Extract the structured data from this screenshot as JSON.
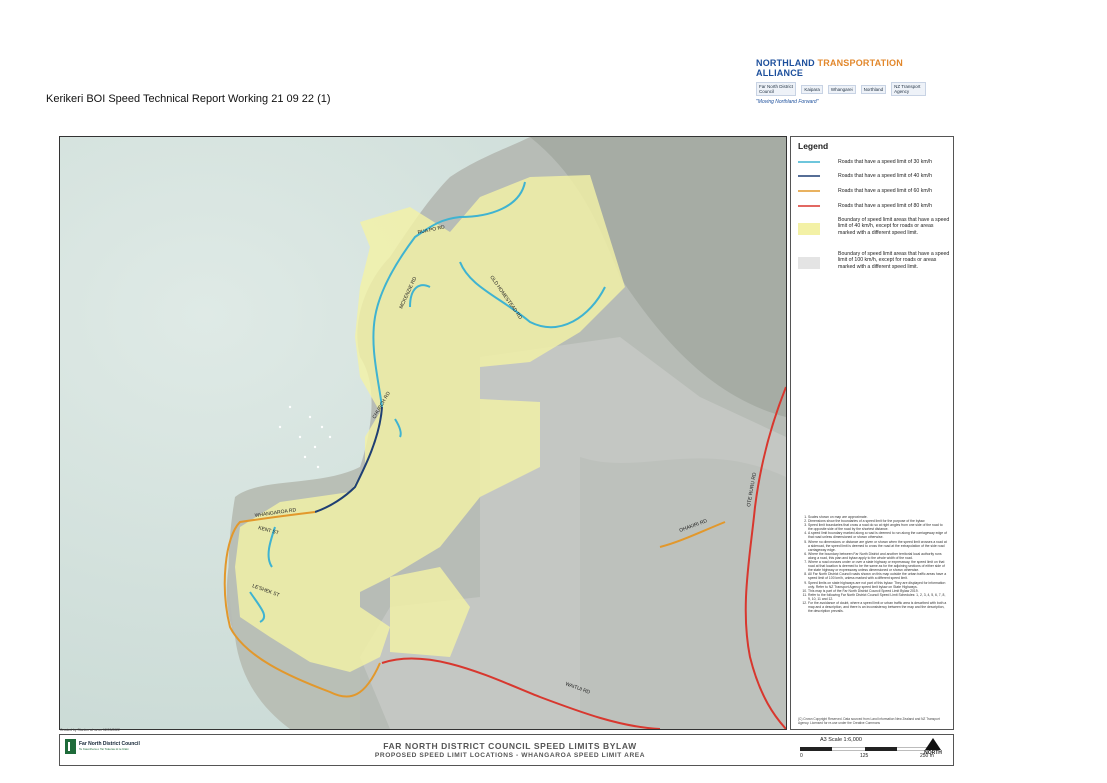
{
  "report_title": "Kerikeri BOI Speed Technical Report Working 21 09 22 (1)",
  "header_logo": {
    "name_part1": "NORTHLAND",
    "name_part2": "TRANSPORTATION",
    "name_part3": "ALLIANCE",
    "partners": [
      "Far North District Council",
      "Kaipara",
      "Whangarei",
      "Northland",
      "NZ Transport Agency"
    ],
    "tagline": "\"Moving Northland Forward\""
  },
  "legend": {
    "title": "Legend",
    "items": [
      {
        "label": "Roads that have a speed limit of 30 km/h",
        "color": "#3fb3d1",
        "kind": "line"
      },
      {
        "label": "Roads that have a speed limit of 40 km/h",
        "color": "#1f3f73",
        "kind": "line"
      },
      {
        "label": "Roads that have a speed limit of 60 km/h",
        "color": "#e2982c",
        "kind": "line"
      },
      {
        "label": "Roads that have a speed limit of 80 km/h",
        "color": "#d8372e",
        "kind": "line"
      },
      {
        "label": "Boundary of speed limit areas that have a speed limit of 40 km/h, except for roads or areas marked with a different speed limit.",
        "color": "#f3f1a6",
        "kind": "area"
      },
      {
        "label": "Boundary of speed limit areas that have a speed limit of 100 km/h, except for roads or areas marked with a different speed limit.",
        "color": "#e4e4e4",
        "kind": "area"
      }
    ],
    "notes": [
      "Scales shown on map are approximate.",
      "Dimensions show the boundaries of a speed limit for the purpose of the bylaw.",
      "Speed limit boundaries that cross a road do so at right angles from one side of the road to the opposite side of the road by the shortest distance.",
      "A speed limit boundary marked along a road is deemed to run along the carriageway edge of that road unless dimensioned or shown otherwise.",
      "Where no dimensions or distance are given or shown when the speed limit crosses a road at a sideroad, the speed limit is deemed to cross the road at the extrapolation of the side road carriageway edge.",
      "Where the boundary between Far North District and another territorial local authority runs along a road, this plan and bylaw apply to the whole width of the road.",
      "Where a road crosses under or over a state highway or expressway, the speed limit on that road at that location is deemed to be the same as for the adjoining sections of either side of the state highway or expressway unless dimensioned or shown otherwise.",
      "All Far North District Council roads shown on this map outside the urban traffic areas have a speed limit of 100 km/h, unless marked with a different speed limit.",
      "Speed limits on state highways are not part of this bylaw. They are displayed for information only. Refer to NZ Transport Agency speed limit bylaw on State Highways.",
      "This map is part of the Far North District Council Speed Limit Bylaw 2019.",
      "Refer to the following Far North District Council Speed Limit Schedules: 1, 2, 3, 4, 5, 6, 7, 8, 9, 10, 11 and 12.",
      "For the avoidance of doubt, where a speed limit or urban traffic area is described with both a map and a description, and there is an inconsistency between the map and the description, the description prevails."
    ],
    "copyright": "(C) Crown Copyright Reserved. Data sourced from Land Information New Zealand and NZ Transport Agency. Licensed for re-use under the Creative Commons"
  },
  "map": {
    "road_labels": [
      "RUA PO RD",
      "OLD HOMESTEAD RD",
      "MCKENZIE RD",
      "CHURCH RD",
      "WHANGAROA RD",
      "KENT ST",
      "LE'SHEK ST",
      "OHAKIRI RD",
      "OTE RURU RD",
      "WAITUI RD"
    ]
  },
  "credit": "Created by Stantec at ns on 12/09/2022",
  "title_block": {
    "council_name": "Far North District Council",
    "council_tagline": "Te Kaunihera o Tai Tokerau ki te Raki",
    "title": "FAR NORTH DISTRICT COUNCIL SPEED LIMITS BYLAW",
    "subtitle": "PROPOSED SPEED LIMIT LOCATIONS - WHANGAROA SPEED LIMIT AREA",
    "scale_text": "A3 Scale 1:6,000",
    "scale_ticks": [
      "0",
      "125",
      "250 m"
    ],
    "north_label": "NORTH"
  }
}
